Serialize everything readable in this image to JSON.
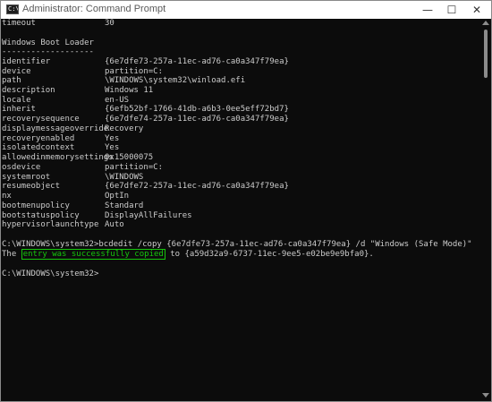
{
  "window": {
    "title": "Administrator: Command Prompt",
    "icon_text": "C:\\",
    "controls": {
      "minimize": "—",
      "maximize": "☐",
      "close": "✕"
    }
  },
  "console": {
    "timeout": {
      "key": "timeout",
      "value": "30"
    },
    "section_title": "Windows Boot Loader",
    "separator": "-------------------",
    "entries": [
      {
        "key": "identifier",
        "value": "{6e7dfe73-257a-11ec-ad76-ca0a347f79ea}"
      },
      {
        "key": "device",
        "value": "partition=C:"
      },
      {
        "key": "path",
        "value": "\\WINDOWS\\system32\\winload.efi"
      },
      {
        "key": "description",
        "value": "Windows 11"
      },
      {
        "key": "locale",
        "value": "en-US"
      },
      {
        "key": "inherit",
        "value": "{6efb52bf-1766-41db-a6b3-0ee5eff72bd7}"
      },
      {
        "key": "recoverysequence",
        "value": "{6e7dfe74-257a-11ec-ad76-ca0a347f79ea}"
      },
      {
        "key": "displaymessageoverride",
        "value": "Recovery"
      },
      {
        "key": "recoveryenabled",
        "value": "Yes"
      },
      {
        "key": "isolatedcontext",
        "value": "Yes"
      },
      {
        "key": "allowedinmemorysettings",
        "value": "0x15000075"
      },
      {
        "key": "osdevice",
        "value": "partition=C:"
      },
      {
        "key": "systemroot",
        "value": "\\WINDOWS"
      },
      {
        "key": "resumeobject",
        "value": "{6e7dfe72-257a-11ec-ad76-ca0a347f79ea}"
      },
      {
        "key": "nx",
        "value": "OptIn"
      },
      {
        "key": "bootmenupolicy",
        "value": "Standard"
      },
      {
        "key": "bootstatuspolicy",
        "value": "DisplayAllFailures"
      },
      {
        "key": "hypervisorlaunchtype",
        "value": "Auto"
      }
    ],
    "command_line": "C:\\WINDOWS\\system32>bcdedit /copy {6e7dfe73-257a-11ec-ad76-ca0a347f79ea} /d \"Windows (Safe Mode)\"",
    "result": {
      "prefix": "The ",
      "highlight": "entry was successfully copied",
      "suffix": " to {a59d32a9-6737-11ec-9ee5-e02be9e9bfa0}."
    },
    "prompt": "C:\\WINDOWS\\system32>"
  },
  "colors": {
    "console_bg": "#0c0c0c",
    "console_text": "#cccccc",
    "success_green": "#16c60c",
    "titlebar_bg": "#ffffff"
  }
}
